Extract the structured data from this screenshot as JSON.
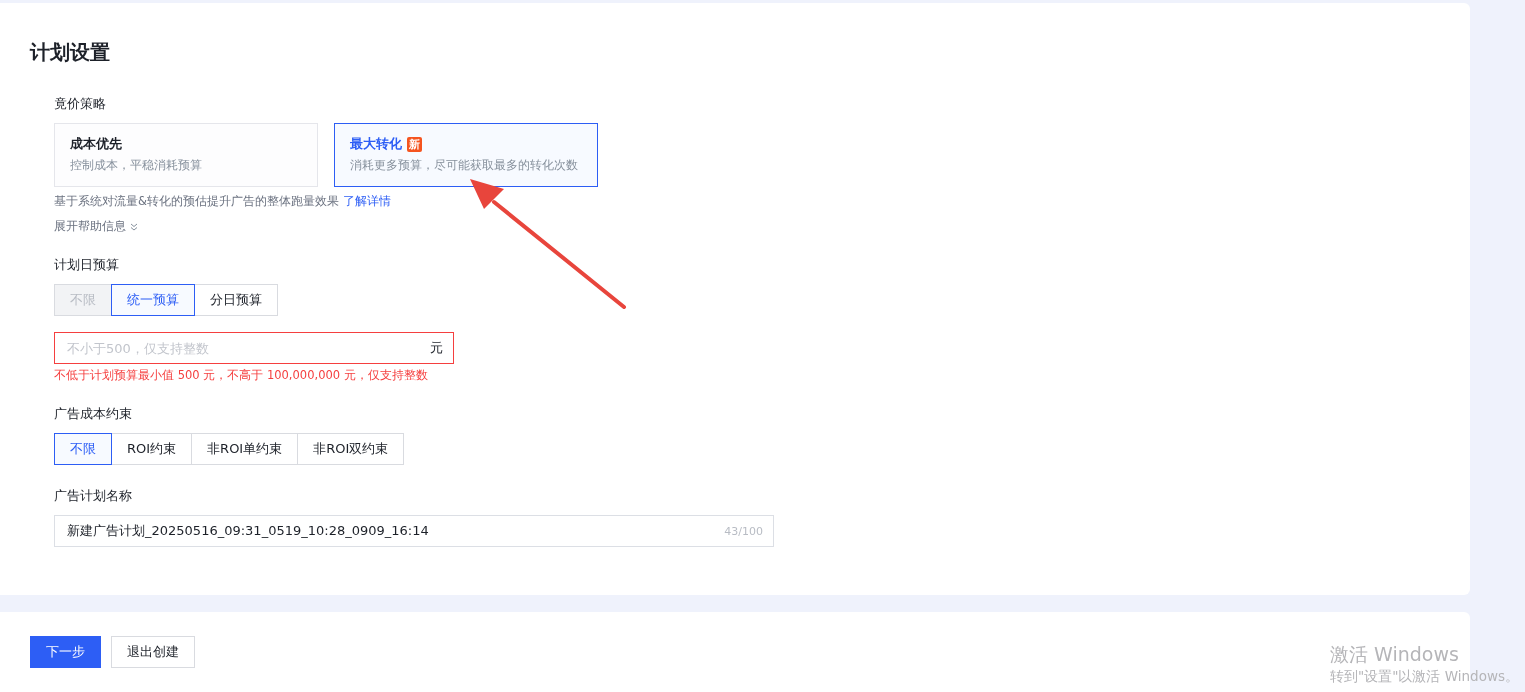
{
  "title": "计划设置",
  "bid_strategy": {
    "label": "竟价策略",
    "options": [
      {
        "title": "成本优先",
        "description": "控制成本，平稳消耗预算",
        "selected": false
      },
      {
        "title": "最大转化",
        "description": "消耗更多预算，尽可能获取最多的转化次数",
        "badge": "新",
        "selected": true
      }
    ],
    "hint": "基于系统对流量&转化的预估提升广告的整体跑量效果",
    "link": "了解详情",
    "expand": "展开帮助信息"
  },
  "daily_budget": {
    "label": "计划日预算",
    "options": [
      {
        "label": "不限",
        "selected": false,
        "disabled": true
      },
      {
        "label": "统一预算",
        "selected": true,
        "disabled": false
      },
      {
        "label": "分日预算",
        "selected": false,
        "disabled": false
      }
    ],
    "input": {
      "placeholder": "不小于500，仅支持整数",
      "suffix": "元",
      "error": true
    },
    "error": "不低于计划预算最小值 500 元，不高于 100,000,000 元，仅支持整数"
  },
  "cost_constraint": {
    "label": "广告成本约束",
    "options": [
      {
        "label": "不限",
        "selected": true,
        "disabled": false
      },
      {
        "label": "ROI约束",
        "selected": false,
        "disabled": false
      },
      {
        "label": "非ROI单约束",
        "selected": false,
        "disabled": false
      },
      {
        "label": "非ROI双约束",
        "selected": false,
        "disabled": false
      }
    ]
  },
  "plan_name": {
    "label": "广告计划名称",
    "value": "新建广告计划_20250516_09:31_0519_10:28_0909_16:14",
    "counter": "43/100"
  },
  "footer": {
    "buttons": [
      {
        "label": "下一步",
        "kind": "primary"
      },
      {
        "label": "退出创建",
        "kind": "default"
      }
    ]
  },
  "os_notice": {
    "title": "激活 Windows",
    "subtitle": "转到\"设置\"以激活 Windows。"
  }
}
